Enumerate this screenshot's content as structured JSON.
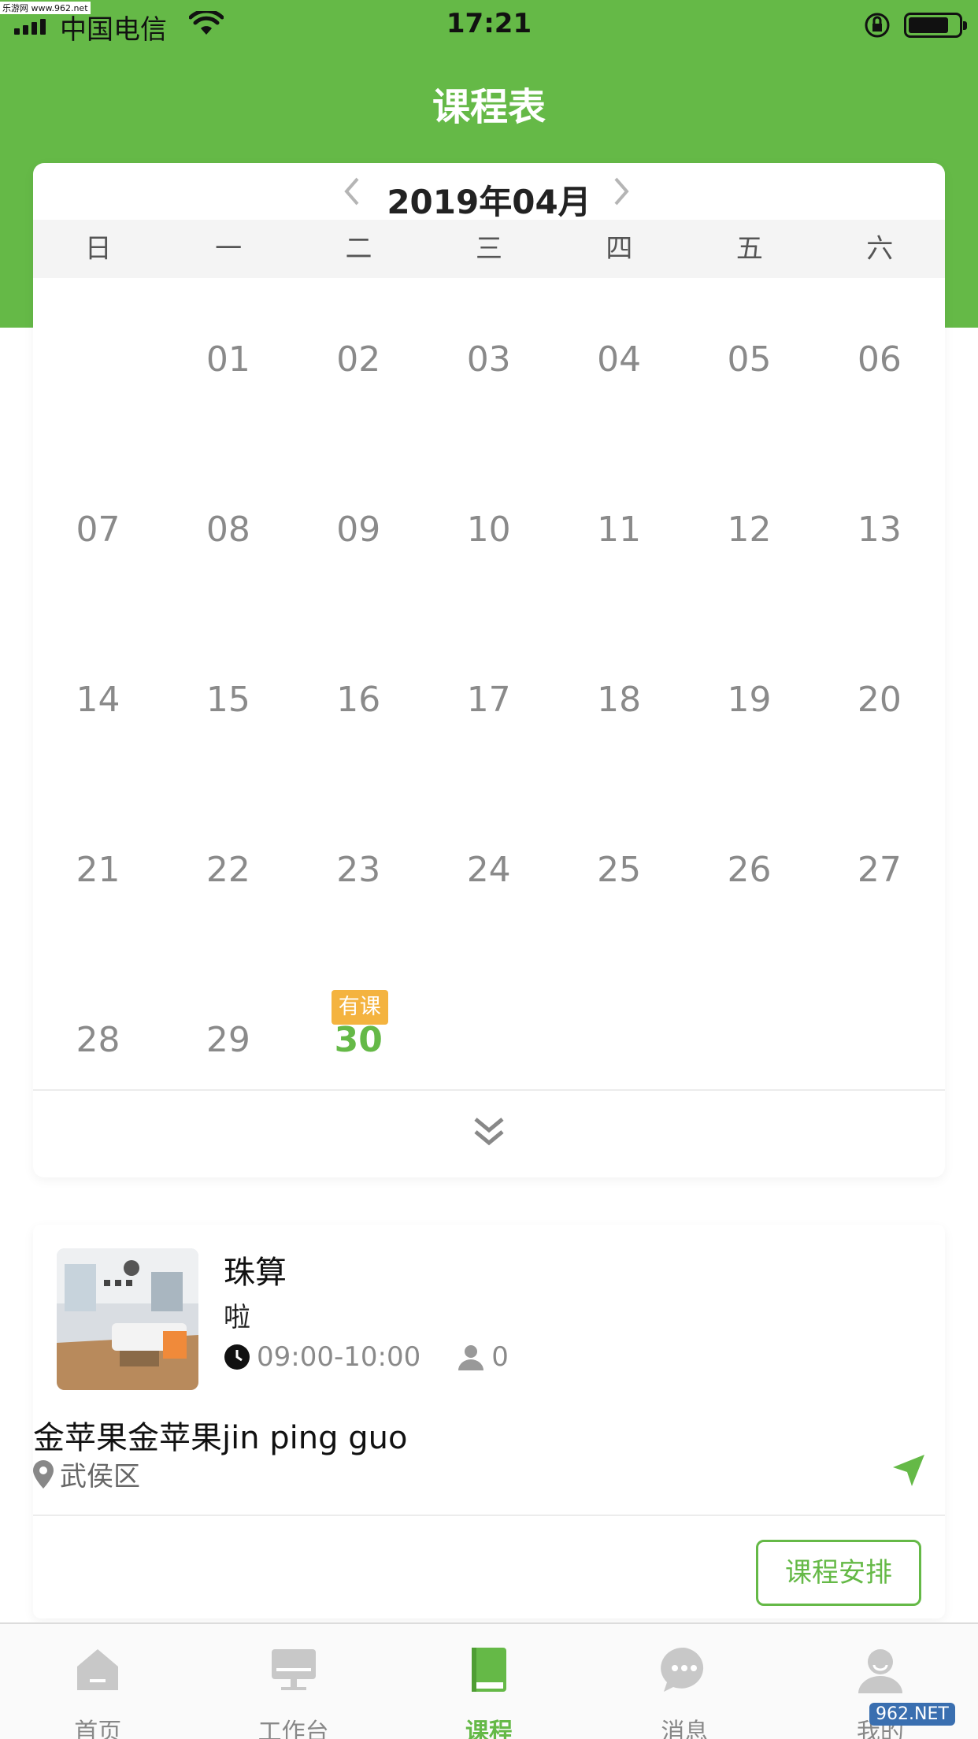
{
  "status_bar": {
    "watermark": "乐游网 www.962.net",
    "carrier": "中国电信",
    "time": "17:21"
  },
  "header": {
    "title": "课程表"
  },
  "calendar": {
    "month": "2019年04月",
    "weekdays": [
      "日",
      "一",
      "二",
      "三",
      "四",
      "五",
      "六"
    ],
    "days": [
      "01",
      "02",
      "03",
      "04",
      "05",
      "06",
      "07",
      "08",
      "09",
      "10",
      "11",
      "12",
      "13",
      "14",
      "15",
      "16",
      "17",
      "18",
      "19",
      "20",
      "21",
      "22",
      "23",
      "24",
      "25",
      "26",
      "27",
      "28",
      "29",
      "30"
    ],
    "first_weekday_index": 1,
    "selected_day": "30",
    "course_tag": "有课"
  },
  "course": {
    "name": "珠算",
    "subtitle": "啦",
    "time": "09:00-10:00",
    "students": "0",
    "location_name": "金苹果金苹果jin ping guo",
    "district": "武侯区",
    "arrange_button": "课程安排"
  },
  "tab_bar": {
    "items": [
      {
        "label": "首页",
        "icon": "home-icon"
      },
      {
        "label": "工作台",
        "icon": "desktop-icon"
      },
      {
        "label": "课程",
        "icon": "book-icon"
      },
      {
        "label": "消息",
        "icon": "chat-icon"
      },
      {
        "label": "我的",
        "icon": "user-icon"
      }
    ],
    "active_index": 2,
    "site_mark": "962.NET"
  },
  "colors": {
    "brand_green": "#65b947",
    "tag_orange": "#f4b33f",
    "day_gray": "#8a8a8a"
  }
}
